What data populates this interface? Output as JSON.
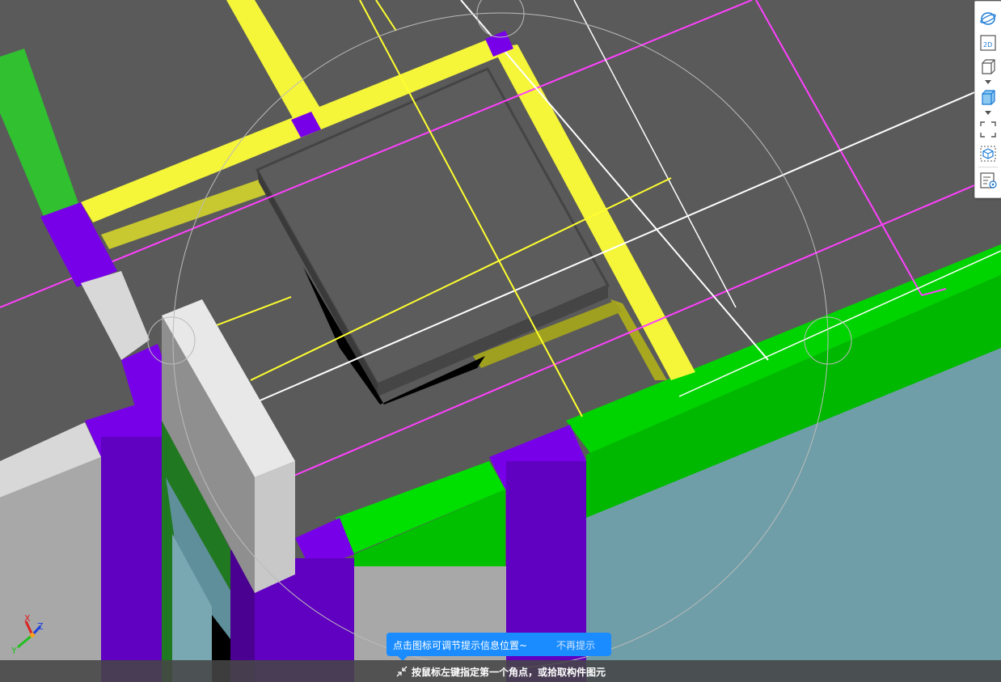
{
  "hint_bubble": {
    "message": "点击图标可调节提示信息位置~",
    "dismiss": "不再提示"
  },
  "status_bar": {
    "prompt": "按鼠标左键指定第一个角点，或拾取构件图元"
  },
  "axis_gizmo": {
    "x_label": "X",
    "y_label": "Y",
    "z_label": "Z"
  },
  "toolbar": {
    "buttons": [
      "orbit-icon",
      "view-2d-icon",
      "view-3d-wire-icon",
      "view-3d-shaded-icon",
      "fit-view-icon",
      "selection-box-icon",
      "properties-icon"
    ],
    "view_2d_text": "2D"
  },
  "colors": {
    "slab": "#5a5a5a",
    "beam_yellow": "#f5f53a",
    "beam_green": "#00c800",
    "column_purple": "#6a00c8",
    "wall_gray": "#a8a8a8",
    "axis_magenta": "#ff40ff",
    "axis_white": "#ffffff",
    "background_teal": "#6f9ea8",
    "accent_blue": "#1a8cff"
  }
}
